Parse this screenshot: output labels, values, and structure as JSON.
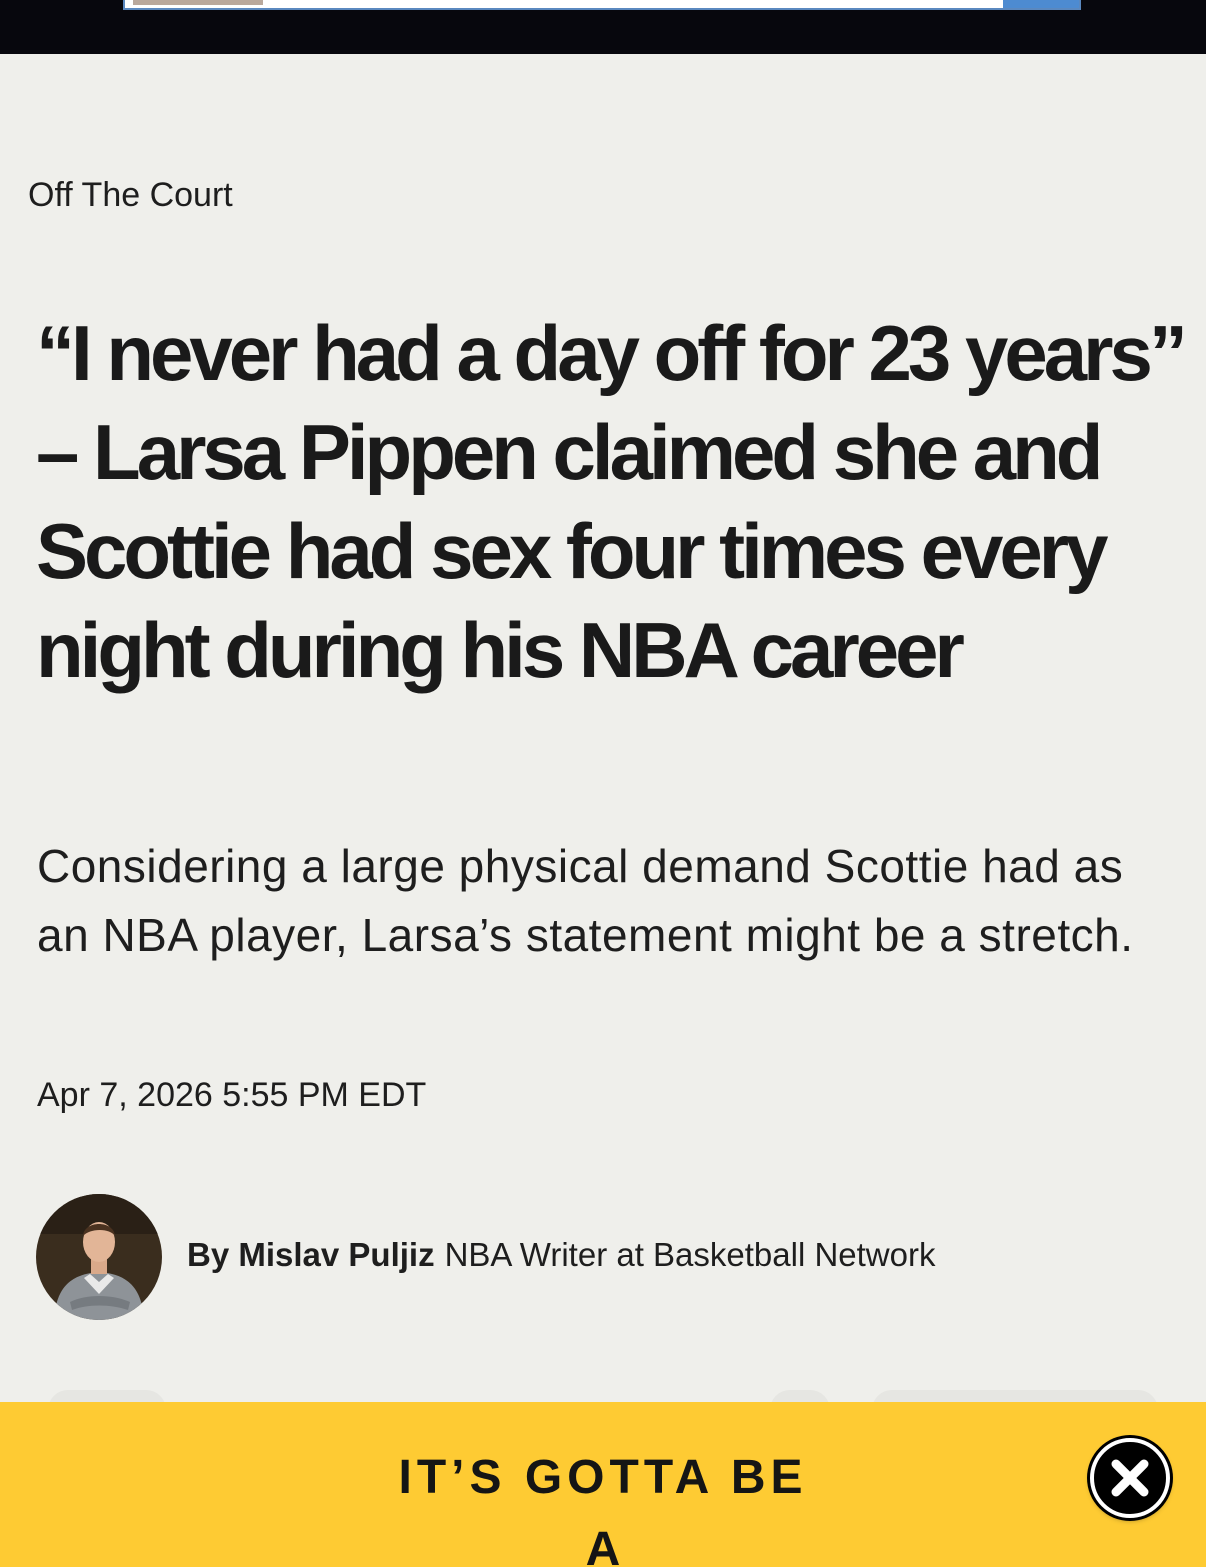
{
  "colors": {
    "background": "#efefeb",
    "top_bar": "#07070d",
    "ad_banner": "#fecb33",
    "text": "#1a1a1a"
  },
  "article": {
    "category": "Off The Court",
    "headline": "“I never had a day off for 23 years” – Larsa Pippen claimed she and Scottie had sex four times every night during his NBA career",
    "subheadline": "Considering a large physical demand Scottie had as an NBA player, Larsa’s statement might be a stretch.",
    "timestamp": "Apr 7, 2026 5:55 PM EDT",
    "byline": {
      "author": "By Mislav Puljiz",
      "role": "NBA Writer at Basketball Network"
    }
  },
  "ad": {
    "line1": "IT’S GOTTA BE",
    "line2": "A",
    "close_icon": "close-icon"
  }
}
